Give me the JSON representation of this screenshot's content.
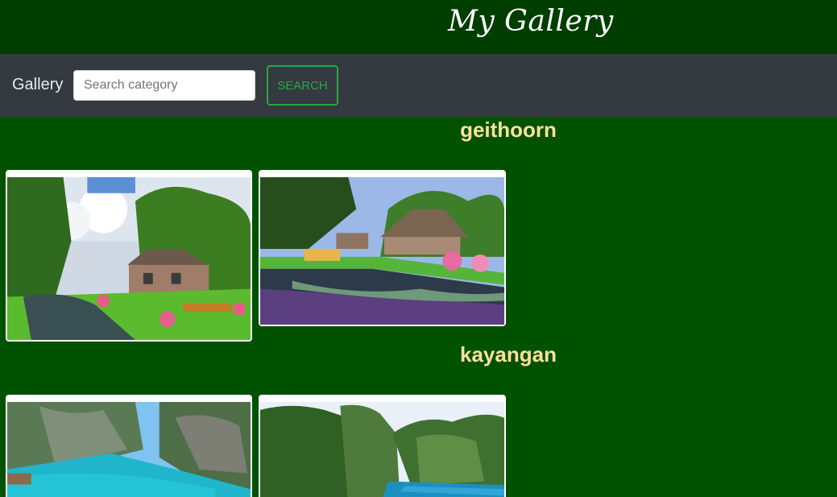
{
  "header": {
    "brand": "My Gallery"
  },
  "navbar": {
    "brand": "Gallery",
    "search_placeholder": "Search category",
    "search_button": "SEARCH"
  },
  "sections": [
    {
      "title": "geithoorn",
      "images": [
        "village-canal-photo",
        "thatched-house-canal-photo"
      ]
    },
    {
      "title": "kayangan",
      "images": [
        "turquoise-lagoon-photo",
        "jungle-lake-photo"
      ]
    }
  ],
  "colors": {
    "page_bg": "#005200",
    "header_bg": "#003e00",
    "navbar_bg": "#343a40",
    "title_color": "#ffe09a",
    "accent": "#28a745"
  }
}
